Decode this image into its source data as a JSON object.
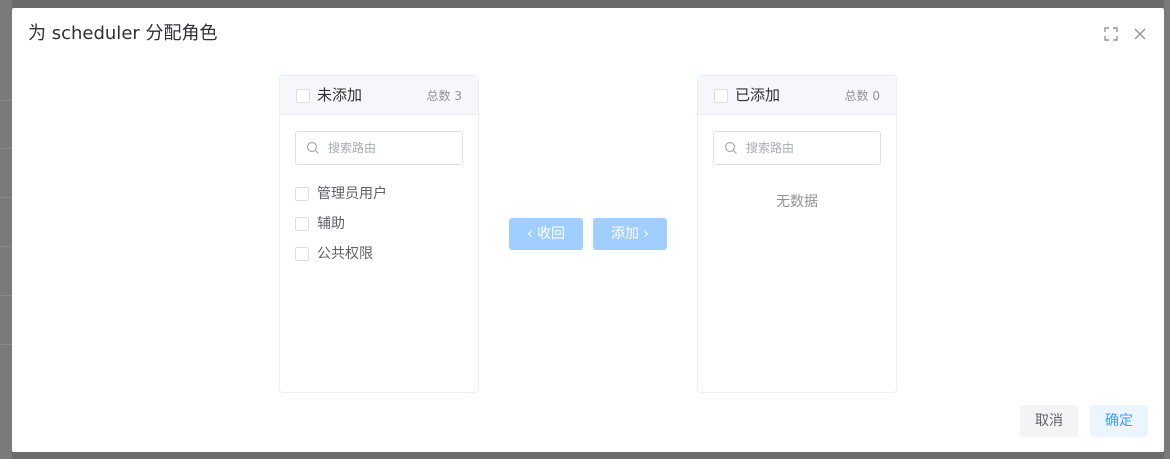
{
  "dialog": {
    "title": "为 scheduler 分配角色",
    "icons": {
      "fullscreen": "fullscreen-icon",
      "close": "close-icon"
    }
  },
  "left_panel": {
    "title": "未添加",
    "count": "总数 3",
    "search_placeholder": "搜索路由",
    "items": [
      {
        "label": "管理员用户"
      },
      {
        "label": "辅助"
      },
      {
        "label": "公共权限"
      }
    ]
  },
  "right_panel": {
    "title": "已添加",
    "count": "总数 0",
    "search_placeholder": "搜索路由",
    "empty_text": "无数据"
  },
  "transfer_buttons": {
    "back_label": "收回",
    "add_label": "添加"
  },
  "footer": {
    "cancel_label": "取消",
    "confirm_label": "确定"
  },
  "colors": {
    "primary": "#409eff",
    "primary_disabled": "#a0cfff",
    "overlay": "#6b6b6b"
  }
}
